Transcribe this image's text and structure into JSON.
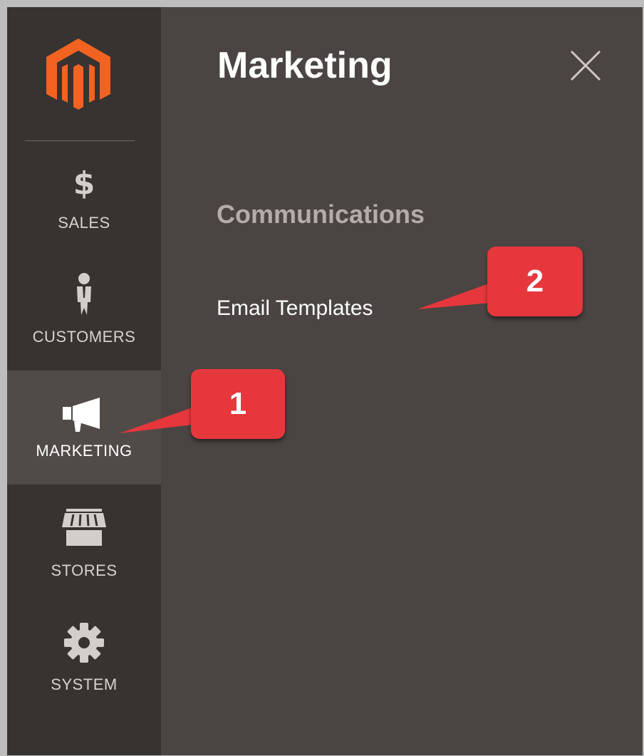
{
  "sidebar": {
    "logo_icon": "magento-logo-icon",
    "items": [
      {
        "label": "SALES",
        "icon": "dollar-icon",
        "glyph": "$"
      },
      {
        "label": "CUSTOMERS",
        "icon": "person-icon"
      },
      {
        "label": "MARKETING",
        "icon": "megaphone-icon",
        "active": true
      },
      {
        "label": "STORES",
        "icon": "storefront-icon"
      },
      {
        "label": "SYSTEM",
        "icon": "gear-icon"
      }
    ]
  },
  "panel": {
    "title": "Marketing",
    "close_icon": "close-icon",
    "section_title": "Communications",
    "links": [
      {
        "label": "Email Templates"
      }
    ]
  },
  "callouts": [
    {
      "number": "1"
    },
    {
      "number": "2"
    }
  ],
  "colors": {
    "panel_bg": "#4a4542",
    "sidebar_bg": "#373331",
    "active_bg": "#514b48",
    "logo_orange": "#f26322",
    "callout_red": "#e6373d"
  }
}
